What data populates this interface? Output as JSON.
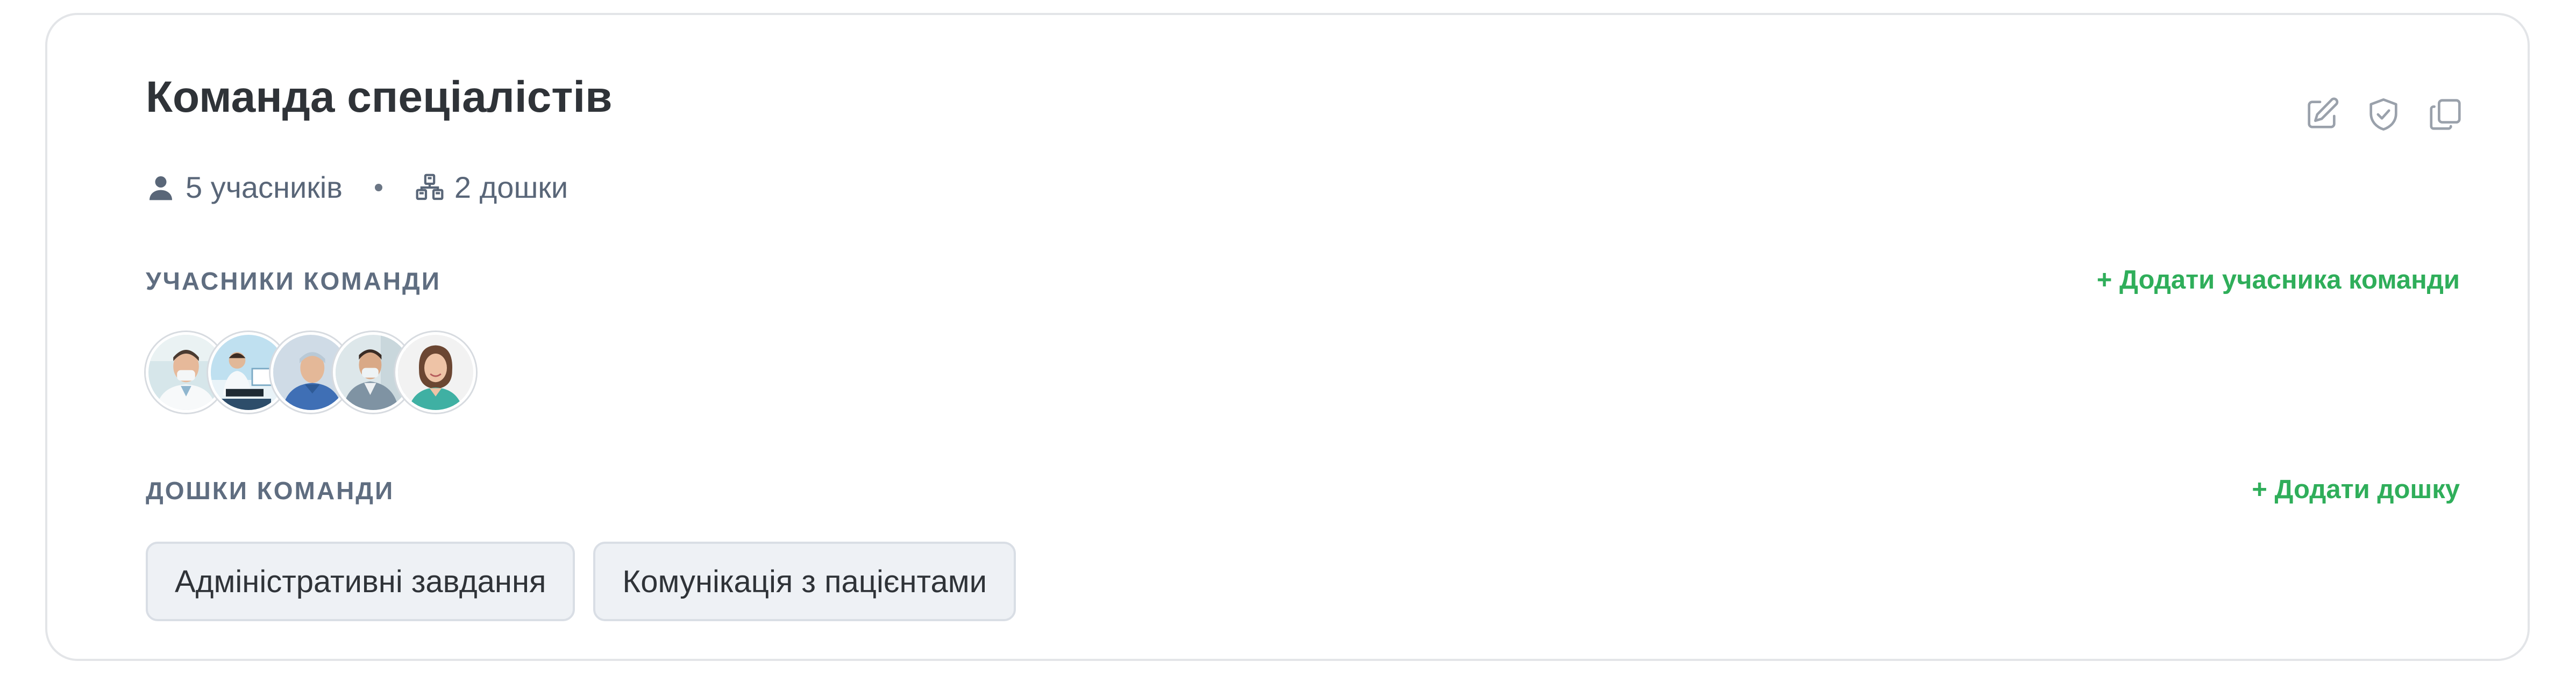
{
  "team": {
    "name": "Команда спеціалістів",
    "members_count_text": "5 учасників",
    "boards_count_text": "2 дошки"
  },
  "actions": [
    {
      "icon": "edit-icon"
    },
    {
      "icon": "shield-check-icon"
    },
    {
      "icon": "copy-icon"
    }
  ],
  "members_section": {
    "label": "Учасники команди",
    "add_label": "+ Додати учасника команди",
    "avatars": [
      {
        "icon": "doctor-avatar-1"
      },
      {
        "icon": "lab-avatar-2"
      },
      {
        "icon": "surgeon-avatar-3"
      },
      {
        "icon": "doctor-mask-avatar-4"
      },
      {
        "icon": "nurse-avatar-5"
      }
    ]
  },
  "boards_section": {
    "label": "Дошки команди",
    "add_label": "+ Додати дошку",
    "boards": [
      {
        "label": "Адміністративні завдання"
      },
      {
        "label": "Комунікація з пацієнтами"
      }
    ]
  },
  "colors": {
    "accent_green": "#2fae5a",
    "title_text": "#2f3338",
    "muted_text": "#596678",
    "chip_bg": "#eef1f5",
    "border": "#e3e5e8"
  }
}
